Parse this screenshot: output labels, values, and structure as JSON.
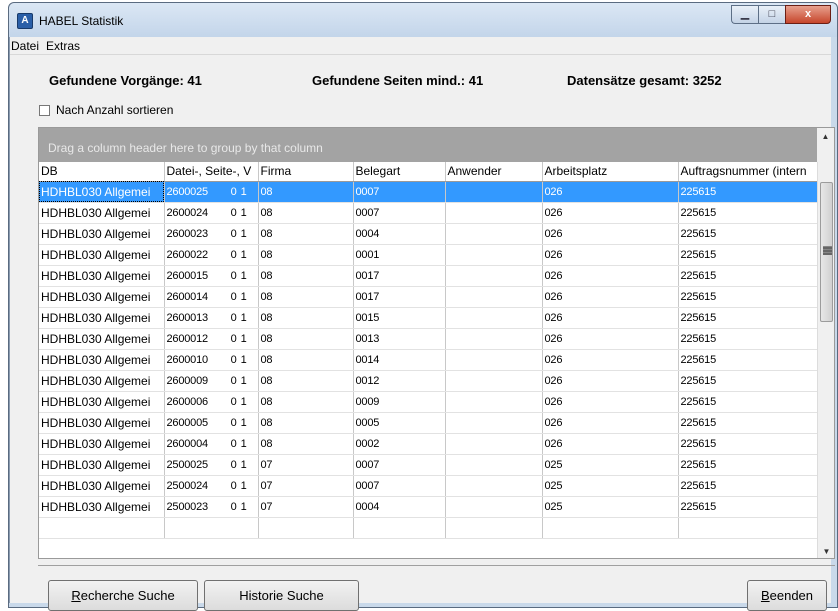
{
  "window": {
    "title": "HABEL Statistik",
    "icon": "habel-app-icon",
    "icon_glyph": "A",
    "minimize_glyph": "▁",
    "maximize_glyph": "□",
    "close_glyph": "x"
  },
  "menu": [
    "Datei",
    "Extras"
  ],
  "stats": {
    "vorgaenge": "Gefundene Vorgänge: 41",
    "seiten": "Gefundene Seiten mind.: 41",
    "datensaetze": "Datensätze gesamt: 3252"
  },
  "sort_checkbox": {
    "label": "Nach Anzahl sortieren",
    "checked": false
  },
  "grid": {
    "group_panel_text": "Drag a column header here to group by that column",
    "columns": [
      "DB",
      "Datei-, Seite-, V",
      "Firma",
      "Belegart",
      "Anwender",
      "Arbeitsplatz",
      "Auftragsnummer (intern"
    ],
    "rows": [
      {
        "db": "HDHBL030 Allgemei",
        "datei": "2600025",
        "n1": "0",
        "n2": "1",
        "firma": "08",
        "belegart": "0007",
        "anwender": "",
        "arbeitsplatz": "026",
        "auftrag": "225615"
      },
      {
        "db": "HDHBL030 Allgemei",
        "datei": "2600024",
        "n1": "0",
        "n2": "1",
        "firma": "08",
        "belegart": "0007",
        "anwender": "",
        "arbeitsplatz": "026",
        "auftrag": "225615"
      },
      {
        "db": "HDHBL030 Allgemei",
        "datei": "2600023",
        "n1": "0",
        "n2": "1",
        "firma": "08",
        "belegart": "0004",
        "anwender": "",
        "arbeitsplatz": "026",
        "auftrag": "225615"
      },
      {
        "db": "HDHBL030 Allgemei",
        "datei": "2600022",
        "n1": "0",
        "n2": "1",
        "firma": "08",
        "belegart": "0001",
        "anwender": "",
        "arbeitsplatz": "026",
        "auftrag": "225615"
      },
      {
        "db": "HDHBL030 Allgemei",
        "datei": "2600015",
        "n1": "0",
        "n2": "1",
        "firma": "08",
        "belegart": "0017",
        "anwender": "",
        "arbeitsplatz": "026",
        "auftrag": "225615"
      },
      {
        "db": "HDHBL030 Allgemei",
        "datei": "2600014",
        "n1": "0",
        "n2": "1",
        "firma": "08",
        "belegart": "0017",
        "anwender": "",
        "arbeitsplatz": "026",
        "auftrag": "225615"
      },
      {
        "db": "HDHBL030 Allgemei",
        "datei": "2600013",
        "n1": "0",
        "n2": "1",
        "firma": "08",
        "belegart": "0015",
        "anwender": "",
        "arbeitsplatz": "026",
        "auftrag": "225615"
      },
      {
        "db": "HDHBL030 Allgemei",
        "datei": "2600012",
        "n1": "0",
        "n2": "1",
        "firma": "08",
        "belegart": "0013",
        "anwender": "",
        "arbeitsplatz": "026",
        "auftrag": "225615"
      },
      {
        "db": "HDHBL030 Allgemei",
        "datei": "2600010",
        "n1": "0",
        "n2": "1",
        "firma": "08",
        "belegart": "0014",
        "anwender": "",
        "arbeitsplatz": "026",
        "auftrag": "225615"
      },
      {
        "db": "HDHBL030 Allgemei",
        "datei": "2600009",
        "n1": "0",
        "n2": "1",
        "firma": "08",
        "belegart": "0012",
        "anwender": "",
        "arbeitsplatz": "026",
        "auftrag": "225615"
      },
      {
        "db": "HDHBL030 Allgemei",
        "datei": "2600006",
        "n1": "0",
        "n2": "1",
        "firma": "08",
        "belegart": "0009",
        "anwender": "",
        "arbeitsplatz": "026",
        "auftrag": "225615"
      },
      {
        "db": "HDHBL030 Allgemei",
        "datei": "2600005",
        "n1": "0",
        "n2": "1",
        "firma": "08",
        "belegart": "0005",
        "anwender": "",
        "arbeitsplatz": "026",
        "auftrag": "225615"
      },
      {
        "db": "HDHBL030 Allgemei",
        "datei": "2600004",
        "n1": "0",
        "n2": "1",
        "firma": "08",
        "belegart": "0002",
        "anwender": "",
        "arbeitsplatz": "026",
        "auftrag": "225615"
      },
      {
        "db": "HDHBL030 Allgemei",
        "datei": "2500025",
        "n1": "0",
        "n2": "1",
        "firma": "07",
        "belegart": "0007",
        "anwender": "",
        "arbeitsplatz": "025",
        "auftrag": "225615"
      },
      {
        "db": "HDHBL030 Allgemei",
        "datei": "2500024",
        "n1": "0",
        "n2": "1",
        "firma": "07",
        "belegart": "0007",
        "anwender": "",
        "arbeitsplatz": "025",
        "auftrag": "225615"
      },
      {
        "db": "HDHBL030 Allgemei",
        "datei": "2500023",
        "n1": "0",
        "n2": "1",
        "firma": "07",
        "belegart": "0004",
        "anwender": "",
        "arbeitsplatz": "025",
        "auftrag": "225615"
      },
      {
        "db": "",
        "datei": "",
        "n1": "",
        "n2": "",
        "firma": "",
        "belegart": "",
        "anwender": "",
        "arbeitsplatz": "",
        "auftrag": ""
      }
    ],
    "selected_row": 0
  },
  "buttons": {
    "recherche": {
      "accel": "R",
      "rest": "echerche Suche"
    },
    "historie": "Historie Suche",
    "beenden": {
      "accel": "B",
      "rest": "eenden"
    }
  },
  "colors": {
    "selection": "#3399ff",
    "group_panel": "#a3a3a3",
    "close_button": "#c6462b"
  }
}
